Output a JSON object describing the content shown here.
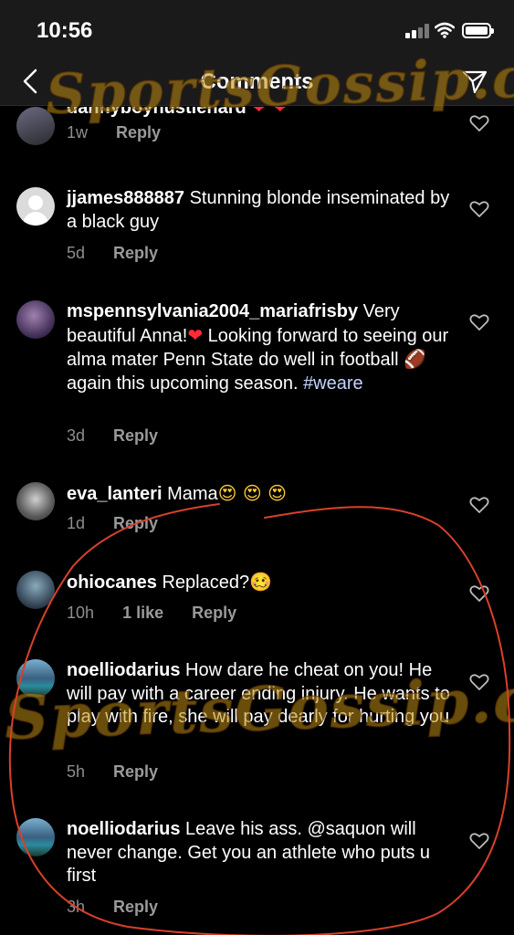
{
  "status_bar": {
    "time": "10:56"
  },
  "nav": {
    "title": "Comments"
  },
  "watermark": {
    "text": "SportsGossip.com"
  },
  "comments": [
    {
      "username": "dannyboyhustlehard",
      "text": "",
      "emoji": "❤ ❤",
      "time": "1w",
      "reply": "Reply"
    },
    {
      "username": "jjames888887",
      "text": "Stunning blonde inseminated by a black guy",
      "time": "5d",
      "reply": "Reply"
    },
    {
      "username": "mspennsylvania2004_mariafrisby",
      "text_before_heart": "Very beautiful Anna!",
      "heart": "❤",
      "text_mid": "Looking forward to seeing our alma mater Penn State do well in football",
      "football": "🏈",
      "text_after": "again this upcoming season.",
      "hashtag": "#weare",
      "time": "3d",
      "reply": "Reply"
    },
    {
      "username": "eva_lanteri",
      "text": "Mama",
      "emoji": "😍 😍 😍",
      "time": "1d",
      "reply": "Reply"
    },
    {
      "username": "ohiocanes",
      "text": "Replaced?",
      "emoji": "🥴",
      "time": "10h",
      "likes": "1 like",
      "reply": "Reply"
    },
    {
      "username": "noelliodarius",
      "text": "How dare he cheat on you! He will pay with a career ending injury. He wants to play with fire, she will pay dearly for hurting you",
      "time": "5h",
      "reply": "Reply"
    },
    {
      "username": "noelliodarius",
      "text": "Leave his ass. @saquon will never change. Get you an athlete who puts u first",
      "time": "3h",
      "reply": "Reply"
    }
  ],
  "colors": {
    "background": "#000000",
    "meta_text": "#8e8e8e",
    "annotation": "#d9402a",
    "watermark": "#be8c14"
  }
}
